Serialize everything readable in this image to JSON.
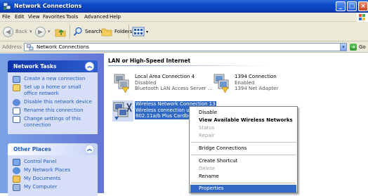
{
  "window": {
    "title": "Network Connections"
  },
  "menubar": [
    "File",
    "Edit",
    "View",
    "Favorites",
    "Tools",
    "Advanced",
    "Help"
  ],
  "toolbar": {
    "back": "Back",
    "search": "Search",
    "folders": "Folders"
  },
  "address": {
    "label": "Address",
    "value": "Network Connections",
    "go": "Go"
  },
  "tasks_panel": {
    "title": "Network Tasks",
    "items": [
      "Create a new connection",
      "Set up a home or small office network",
      "Disable this network device",
      "Rename this connection",
      "Change settings of this connection"
    ]
  },
  "places_panel": {
    "title": "Other Places",
    "items": [
      "Control Panel",
      "My Network Places",
      "My Documents",
      "My Computer"
    ]
  },
  "main": {
    "group_title": "LAN or High-Speed Internet",
    "connections": [
      {
        "name": "Local Area Connection 4",
        "status": "Disabled",
        "device": "Bluetooth LAN Access Server ..."
      },
      {
        "name": "1394 Connection",
        "status": "Enabled",
        "device": "1394 Net Adapter"
      },
      {
        "name": "Wireless Network Connection 13",
        "status": "Wireless connection una",
        "device": "802.11a/b Plus Cardbus"
      }
    ]
  },
  "context_menu": {
    "items": [
      {
        "label": "Disable",
        "state": "normal"
      },
      {
        "label": "View Available Wireless Networks",
        "state": "bold"
      },
      {
        "label": "Status",
        "state": "disabled"
      },
      {
        "label": "Repair",
        "state": "disabled"
      },
      {
        "label": "Bridge Connections",
        "state": "normal"
      },
      {
        "label": "Create Shortcut",
        "state": "normal"
      },
      {
        "label": "Delete",
        "state": "disabled"
      },
      {
        "label": "Rename",
        "state": "normal"
      },
      {
        "label": "Properties",
        "state": "highlighted"
      }
    ]
  },
  "colors": {
    "title_bar": "#0b49c9",
    "task_pane": "#6f8fe0",
    "selection": "#316ac5",
    "link": "#215dc6"
  }
}
